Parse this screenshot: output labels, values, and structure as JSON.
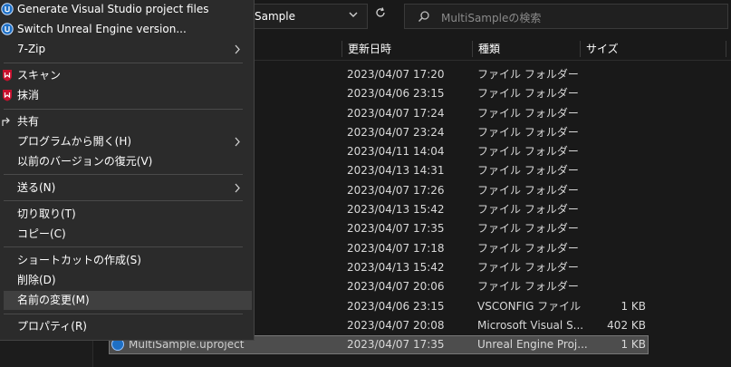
{
  "address": {
    "path": "Sample"
  },
  "search": {
    "placeholder": "MultiSampleの検索"
  },
  "columns": {
    "date": "更新日時",
    "type": "種類",
    "size": "サイズ"
  },
  "files": [
    {
      "name": "",
      "date": "2023/04/07 17:20",
      "type": "ファイル フォルダー",
      "size": ""
    },
    {
      "name": "",
      "date": "2023/04/06 23:15",
      "type": "ファイル フォルダー",
      "size": ""
    },
    {
      "name": "",
      "date": "2023/04/07 17:24",
      "type": "ファイル フォルダー",
      "size": ""
    },
    {
      "name": "",
      "date": "2023/04/07 23:24",
      "type": "ファイル フォルダー",
      "size": ""
    },
    {
      "name": "",
      "date": "2023/04/11 14:04",
      "type": "ファイル フォルダー",
      "size": ""
    },
    {
      "name": "",
      "date": "2023/04/13 14:31",
      "type": "ファイル フォルダー",
      "size": ""
    },
    {
      "name": "",
      "date": "2023/04/07 17:26",
      "type": "ファイル フォルダー",
      "size": ""
    },
    {
      "name": "",
      "date": "2023/04/13 15:42",
      "type": "ファイル フォルダー",
      "size": ""
    },
    {
      "name": "",
      "date": "2023/04/07 17:35",
      "type": "ファイル フォルダー",
      "size": ""
    },
    {
      "name": "",
      "date": "2023/04/07 17:18",
      "type": "ファイル フォルダー",
      "size": ""
    },
    {
      "name": "",
      "date": "2023/04/13 15:42",
      "type": "ファイル フォルダー",
      "size": ""
    },
    {
      "name": "",
      "date": "2023/04/07 20:06",
      "type": "ファイル フォルダー",
      "size": ""
    },
    {
      "name": "",
      "date": "2023/04/06 23:15",
      "type": "VSCONFIG ファイル",
      "size": "1 KB"
    },
    {
      "name": "",
      "date": "2023/04/07 20:08",
      "type": "Microsoft Visual S...",
      "size": "402 KB"
    },
    {
      "name": "MultiSample.uproject",
      "date": "2023/04/07 17:35",
      "type": "Unreal Engine Proj...",
      "size": "1 KB"
    }
  ],
  "menu": {
    "generate_vs": "Generate Visual Studio project files",
    "switch_ue": "Switch Unreal Engine version...",
    "zip": "7-Zip",
    "scan": "スキャン",
    "erase": "抹消",
    "share": "共有",
    "open_with": "プログラムから開く(H)",
    "restore": "以前のバージョンの復元(V)",
    "send_to": "送る(N)",
    "cut": "切り取り(T)",
    "copy": "コピー(C)",
    "shortcut": "ショートカットの作成(S)",
    "delete": "削除(D)",
    "rename": "名前の変更(M)",
    "properties": "プロパティ(R)"
  },
  "colors": {
    "ue_blue": "#1e6fc4",
    "mcafee_red": "#c8102e",
    "menu_bg": "#2b2b2b",
    "selected_row": "#4d4d4d"
  }
}
